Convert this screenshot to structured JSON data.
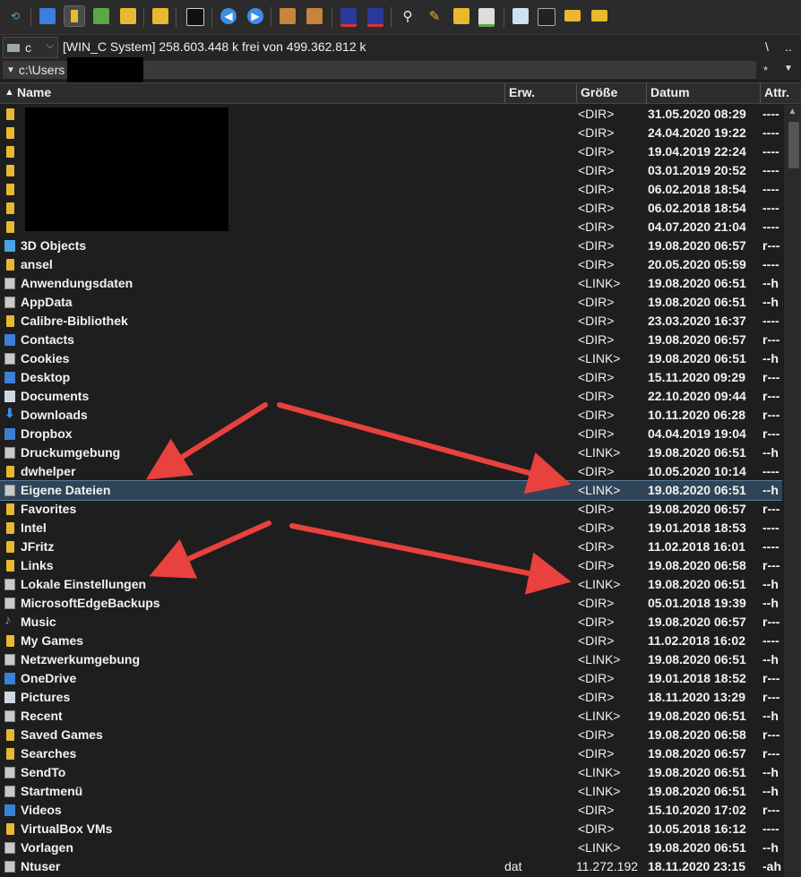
{
  "toolbar": {
    "icons": [
      "refresh-icon",
      "brief-view-icon",
      "full-view-icon",
      "thumbnail-view-icon",
      "tree-view-icon",
      "compare-icon",
      "invert-selection-icon",
      "back-icon",
      "forward-icon",
      "pack-icon",
      "unpack-icon",
      "ftp-connect-icon",
      "ftp-new-icon",
      "search-icon",
      "multi-rename-icon",
      "sync-icon",
      "notepad-icon",
      "list-file-icon",
      "terminal-icon",
      "folder-icon",
      "folder-2-icon"
    ]
  },
  "drive": {
    "letter": "c",
    "info": "[WIN_C System]  258.603.448 k frei von 499.362.812 k",
    "root": "\\",
    "up": ".."
  },
  "path": {
    "value": "c:\\Users",
    "filter_icon": "*",
    "history_icon": "▼"
  },
  "columns": {
    "name": "Name",
    "ext": "Erw.",
    "size": "Größe",
    "date": "Datum",
    "attr": "Attr."
  },
  "rows": [
    {
      "name": "",
      "ext": "",
      "size": "<DIR>",
      "date": "31.05.2020 08:29",
      "attr": "----",
      "icon": "folder"
    },
    {
      "name": "",
      "ext": "",
      "size": "<DIR>",
      "date": "24.04.2020 19:22",
      "attr": "----",
      "icon": "folder"
    },
    {
      "name": "",
      "ext": "",
      "size": "<DIR>",
      "date": "19.04.2019 22:24",
      "attr": "----",
      "icon": "folder"
    },
    {
      "name": "",
      "ext": "",
      "size": "<DIR>",
      "date": "03.01.2019 20:52",
      "attr": "----",
      "icon": "folder"
    },
    {
      "name": "",
      "ext": "",
      "size": "<DIR>",
      "date": "06.02.2018 18:54",
      "attr": "----",
      "icon": "folder"
    },
    {
      "name": "",
      "ext": "",
      "size": "<DIR>",
      "date": "06.02.2018 18:54",
      "attr": "----",
      "icon": "folder"
    },
    {
      "name": "",
      "ext": "",
      "size": "<DIR>",
      "date": "04.07.2020 21:04",
      "attr": "----",
      "icon": "folder"
    },
    {
      "name": "3D Objects",
      "ext": "",
      "size": "<DIR>",
      "date": "19.08.2020 06:57",
      "attr": "r---",
      "icon": "cube"
    },
    {
      "name": "ansel",
      "ext": "",
      "size": "<DIR>",
      "date": "20.05.2020 05:59",
      "attr": "----",
      "icon": "folder"
    },
    {
      "name": "Anwendungsdaten",
      "ext": "",
      "size": "<LINK>",
      "date": "19.08.2020 06:51",
      "attr": "--h",
      "icon": "link"
    },
    {
      "name": "AppData",
      "ext": "",
      "size": "<DIR>",
      "date": "19.08.2020 06:51",
      "attr": "--h",
      "icon": "link"
    },
    {
      "name": "Calibre-Bibliothek",
      "ext": "",
      "size": "<DIR>",
      "date": "23.03.2020 16:37",
      "attr": "----",
      "icon": "folder"
    },
    {
      "name": "Contacts",
      "ext": "",
      "size": "<DIR>",
      "date": "19.08.2020 06:57",
      "attr": "r---",
      "icon": "blue"
    },
    {
      "name": "Cookies",
      "ext": "",
      "size": "<LINK>",
      "date": "19.08.2020 06:51",
      "attr": "--h",
      "icon": "link"
    },
    {
      "name": "Desktop",
      "ext": "",
      "size": "<DIR>",
      "date": "15.11.2020 09:29",
      "attr": "r---",
      "icon": "blue"
    },
    {
      "name": "Documents",
      "ext": "",
      "size": "<DIR>",
      "date": "22.10.2020 09:44",
      "attr": "r---",
      "icon": "doc"
    },
    {
      "name": "Downloads",
      "ext": "",
      "size": "<DIR>",
      "date": "10.11.2020 06:28",
      "attr": "r---",
      "icon": "dl"
    },
    {
      "name": "Dropbox",
      "ext": "",
      "size": "<DIR>",
      "date": "04.04.2019 19:04",
      "attr": "r---",
      "icon": "blue"
    },
    {
      "name": "Druckumgebung",
      "ext": "",
      "size": "<LINK>",
      "date": "19.08.2020 06:51",
      "attr": "--h",
      "icon": "link"
    },
    {
      "name": "dwhelper",
      "ext": "",
      "size": "<DIR>",
      "date": "10.05.2020 10:14",
      "attr": "----",
      "icon": "folder"
    },
    {
      "name": "Eigene Dateien",
      "ext": "",
      "size": "<LINK>",
      "date": "19.08.2020 06:51",
      "attr": "--h",
      "icon": "link",
      "selected": true
    },
    {
      "name": "Favorites",
      "ext": "",
      "size": "<DIR>",
      "date": "19.08.2020 06:57",
      "attr": "r---",
      "icon": "folder"
    },
    {
      "name": "Intel",
      "ext": "",
      "size": "<DIR>",
      "date": "19.01.2018 18:53",
      "attr": "----",
      "icon": "folder"
    },
    {
      "name": "JFritz",
      "ext": "",
      "size": "<DIR>",
      "date": "11.02.2018 16:01",
      "attr": "----",
      "icon": "folder"
    },
    {
      "name": "Links",
      "ext": "",
      "size": "<DIR>",
      "date": "19.08.2020 06:58",
      "attr": "r---",
      "icon": "folder"
    },
    {
      "name": "Lokale Einstellungen",
      "ext": "",
      "size": "<LINK>",
      "date": "19.08.2020 06:51",
      "attr": "--h",
      "icon": "link"
    },
    {
      "name": "MicrosoftEdgeBackups",
      "ext": "",
      "size": "<DIR>",
      "date": "05.01.2018 19:39",
      "attr": "--h",
      "icon": "link"
    },
    {
      "name": "Music",
      "ext": "",
      "size": "<DIR>",
      "date": "19.08.2020 06:57",
      "attr": "r---",
      "icon": "music"
    },
    {
      "name": "My Games",
      "ext": "",
      "size": "<DIR>",
      "date": "11.02.2018 16:02",
      "attr": "----",
      "icon": "folder"
    },
    {
      "name": "Netzwerkumgebung",
      "ext": "",
      "size": "<LINK>",
      "date": "19.08.2020 06:51",
      "attr": "--h",
      "icon": "link"
    },
    {
      "name": "OneDrive",
      "ext": "",
      "size": "<DIR>",
      "date": "19.01.2018 18:52",
      "attr": "r---",
      "icon": "blue"
    },
    {
      "name": "Pictures",
      "ext": "",
      "size": "<DIR>",
      "date": "18.11.2020 13:29",
      "attr": "r---",
      "icon": "doc"
    },
    {
      "name": "Recent",
      "ext": "",
      "size": "<LINK>",
      "date": "19.08.2020 06:51",
      "attr": "--h",
      "icon": "link"
    },
    {
      "name": "Saved Games",
      "ext": "",
      "size": "<DIR>",
      "date": "19.08.2020 06:58",
      "attr": "r---",
      "icon": "folder"
    },
    {
      "name": "Searches",
      "ext": "",
      "size": "<DIR>",
      "date": "19.08.2020 06:57",
      "attr": "r---",
      "icon": "folder"
    },
    {
      "name": "SendTo",
      "ext": "",
      "size": "<LINK>",
      "date": "19.08.2020 06:51",
      "attr": "--h",
      "icon": "link"
    },
    {
      "name": "Startmenü",
      "ext": "",
      "size": "<LINK>",
      "date": "19.08.2020 06:51",
      "attr": "--h",
      "icon": "link"
    },
    {
      "name": "Videos",
      "ext": "",
      "size": "<DIR>",
      "date": "15.10.2020 17:02",
      "attr": "r---",
      "icon": "blue"
    },
    {
      "name": "VirtualBox VMs",
      "ext": "",
      "size": "<DIR>",
      "date": "10.05.2018 16:12",
      "attr": "----",
      "icon": "folder"
    },
    {
      "name": "Vorlagen",
      "ext": "",
      "size": "<LINK>",
      "date": "19.08.2020 06:51",
      "attr": "--h",
      "icon": "link"
    },
    {
      "name": "Ntuser",
      "ext": "dat",
      "size": "11.272.192",
      "date": "18.11.2020 23:15",
      "attr": "-ah",
      "icon": "link"
    }
  ],
  "colors": {
    "selection": "#2f4456",
    "annotation_arrow": "#e8413e",
    "folder": "#e8b930"
  }
}
